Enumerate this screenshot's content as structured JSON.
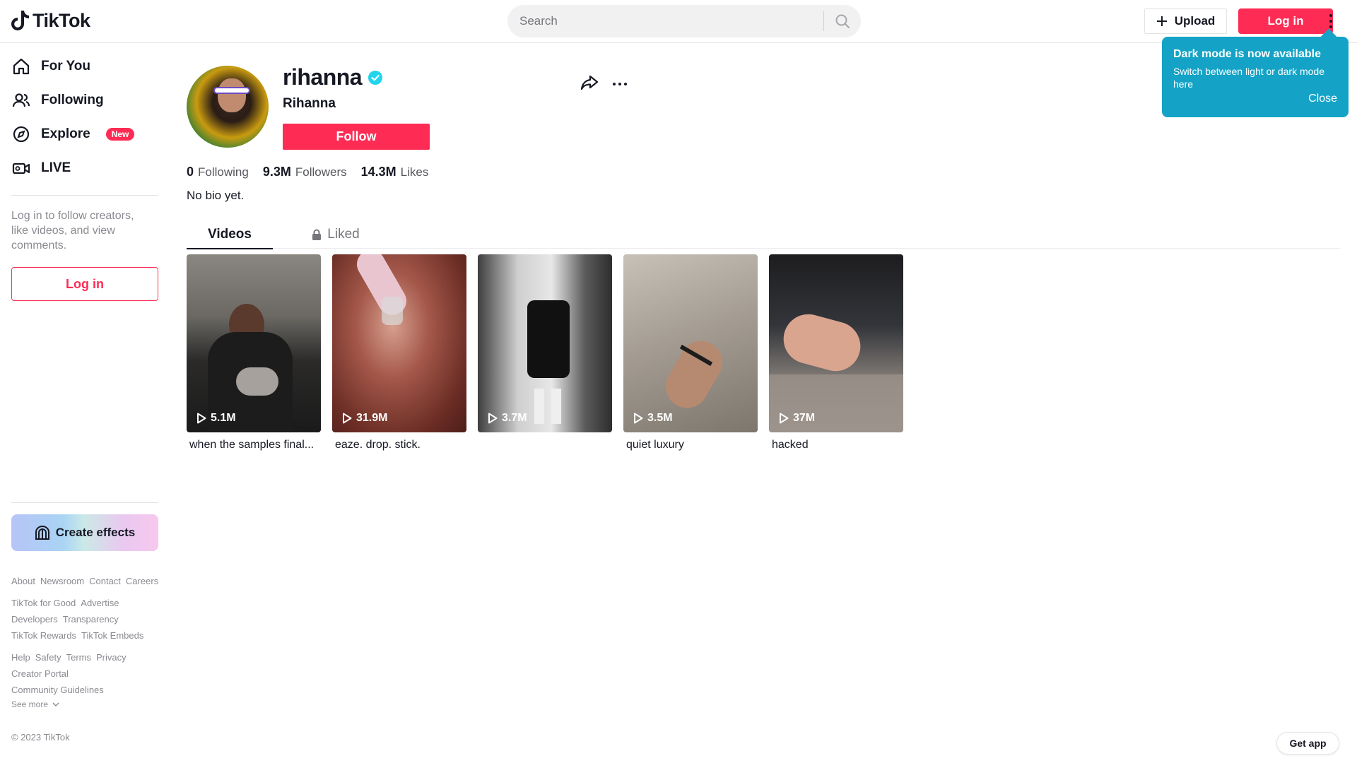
{
  "header": {
    "logo_text": "TikTok",
    "search_placeholder": "Search",
    "upload_label": "Upload",
    "login_label": "Log in"
  },
  "tooltip": {
    "title": "Dark mode is now available",
    "body": "Switch between light or dark mode here",
    "close_label": "Close"
  },
  "sidebar": {
    "items": [
      {
        "label": "For You",
        "icon": "home-icon"
      },
      {
        "label": "Following",
        "icon": "following-icon"
      },
      {
        "label": "Explore",
        "icon": "compass-icon",
        "badge": "New"
      },
      {
        "label": "LIVE",
        "icon": "live-icon"
      }
    ],
    "login_message": "Log in to follow creators, like videos, and view comments.",
    "login_button": "Log in",
    "create_effects": "Create effects",
    "footer_rows": [
      [
        "About",
        "Newsroom",
        "Contact",
        "Careers"
      ],
      [
        "TikTok for Good",
        "Advertise"
      ],
      [
        "Developers",
        "Transparency"
      ],
      [
        "TikTok Rewards",
        "TikTok Embeds"
      ],
      [
        "Help",
        "Safety",
        "Terms",
        "Privacy"
      ],
      [
        "Creator Portal"
      ],
      [
        "Community Guidelines"
      ]
    ],
    "see_more": "See more",
    "copyright": "© 2023 TikTok"
  },
  "profile": {
    "username": "rihanna",
    "display_name": "Rihanna",
    "follow_label": "Follow",
    "stats": {
      "following": {
        "num": "0",
        "label": "Following"
      },
      "followers": {
        "num": "9.3M",
        "label": "Followers"
      },
      "likes": {
        "num": "14.3M",
        "label": "Likes"
      }
    },
    "bio": "No bio yet."
  },
  "tabs": {
    "videos": "Videos",
    "liked": "Liked"
  },
  "videos": [
    {
      "views": "5.1M",
      "caption": "when the samples final..."
    },
    {
      "views": "31.9M",
      "caption": "eaze. drop. stick."
    },
    {
      "views": "3.7M",
      "caption": ""
    },
    {
      "views": "3.5M",
      "caption": "quiet luxury"
    },
    {
      "views": "37M",
      "caption": "hacked"
    }
  ],
  "get_app": "Get app",
  "colors": {
    "brand": "#fe2c55",
    "tooltip": "#14a3c6",
    "verified": "#20d5ec"
  }
}
